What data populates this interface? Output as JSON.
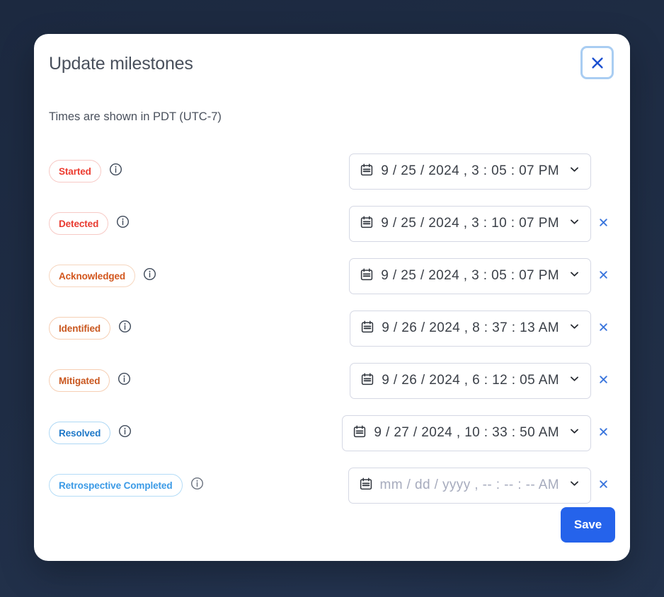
{
  "dialog": {
    "title": "Update milestones",
    "timezone_note": "Times are shown in PDT (UTC-7)",
    "close_label": "Close",
    "save_label": "Save"
  },
  "placeholder": {
    "date": "mm / dd / yyyy ,",
    "time": "-- : -- : --",
    "meridiem": "AM"
  },
  "colors": {
    "accent": "#2563eb",
    "red": "#e8392f",
    "orange": "#d2561d",
    "blue": "#1e78c8",
    "lightblue": "#3b9ae6",
    "modal_bg": "#ffffff",
    "page_bg": "#1e2b42"
  },
  "rows": [
    {
      "badge": "Started",
      "badge_color": "#ec3b2f",
      "badge_border": "#f7c9c5",
      "info_color": "#3f4a5a",
      "value": "9 / 25 / 2024 ,  3 : 05 : 07  PM",
      "empty": false,
      "clearable": false
    },
    {
      "badge": "Detected",
      "badge_color": "#e8392f",
      "badge_border": "#f7c9c5",
      "info_color": "#3f4a5a",
      "value": "9 / 25 / 2024 ,  3 : 10 : 07  PM",
      "empty": false,
      "clearable": true
    },
    {
      "badge": "Acknowledged",
      "badge_color": "#d2561d",
      "badge_border": "#f6d6bf",
      "info_color": "#3f4a5a",
      "value": "9 / 25 / 2024 ,  3 : 05 : 07  PM",
      "empty": false,
      "clearable": true
    },
    {
      "badge": "Identified",
      "badge_color": "#c9571f",
      "badge_border": "#f6cfb4",
      "info_color": "#3f4a5a",
      "value": "9 / 26 / 2024 ,  8 : 37 : 13  AM",
      "empty": false,
      "clearable": true
    },
    {
      "badge": "Mitigated",
      "badge_color": "#c9571f",
      "badge_border": "#f6cfb4",
      "info_color": "#3f4a5a",
      "value": "9 / 26 / 2024 ,  6 : 12 : 05  AM",
      "empty": false,
      "clearable": true
    },
    {
      "badge": "Resolved",
      "badge_color": "#1e78c8",
      "badge_border": "#aed8f5",
      "info_color": "#3f4a5a",
      "value": "9 / 27 / 2024 , 10 : 33 : 50  AM",
      "empty": false,
      "clearable": true
    },
    {
      "badge": "Retrospective Completed",
      "badge_color": "#3b9ae6",
      "badge_border": "#b4dcf7",
      "info_color": "#6c737f",
      "value": "",
      "empty": true,
      "clearable": true
    }
  ],
  "icons": {
    "close": "close-icon",
    "info": "info-icon",
    "calendar": "calendar-icon",
    "chevron": "chevron-down-icon",
    "clear": "clear-icon"
  }
}
